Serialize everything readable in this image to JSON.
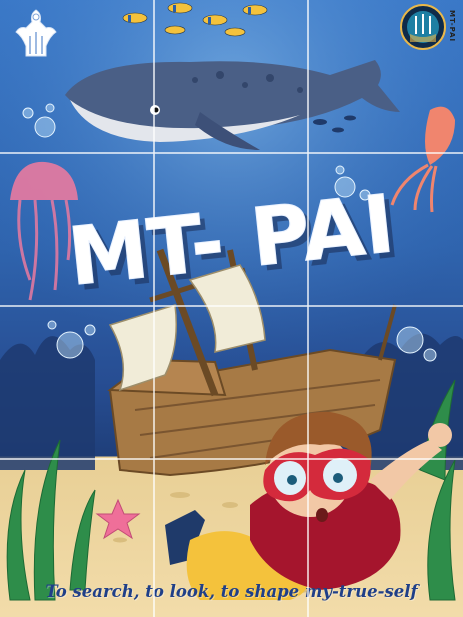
{
  "cover": {
    "title": "MT- PAI",
    "tagline": "To search, to look, to shape my-true-self",
    "seal_text": "MT-PAI",
    "colors": {
      "water_top": "#3a78c7",
      "water_deep": "#1f3f7a",
      "sand": "#f2dcaa",
      "title_text": "#ffffff",
      "tagline_text": "#1f3f88",
      "grid_lines": "#ffffff"
    },
    "icons": [
      "bird-emblem-icon",
      "seal-logo-icon",
      "whale-icon",
      "jellyfish-icon",
      "squid-icon",
      "shipwreck-icon",
      "diver-boy-icon",
      "starfish-icon",
      "fish-school-icon",
      "seaweed-icon",
      "bubbles-icon"
    ]
  }
}
